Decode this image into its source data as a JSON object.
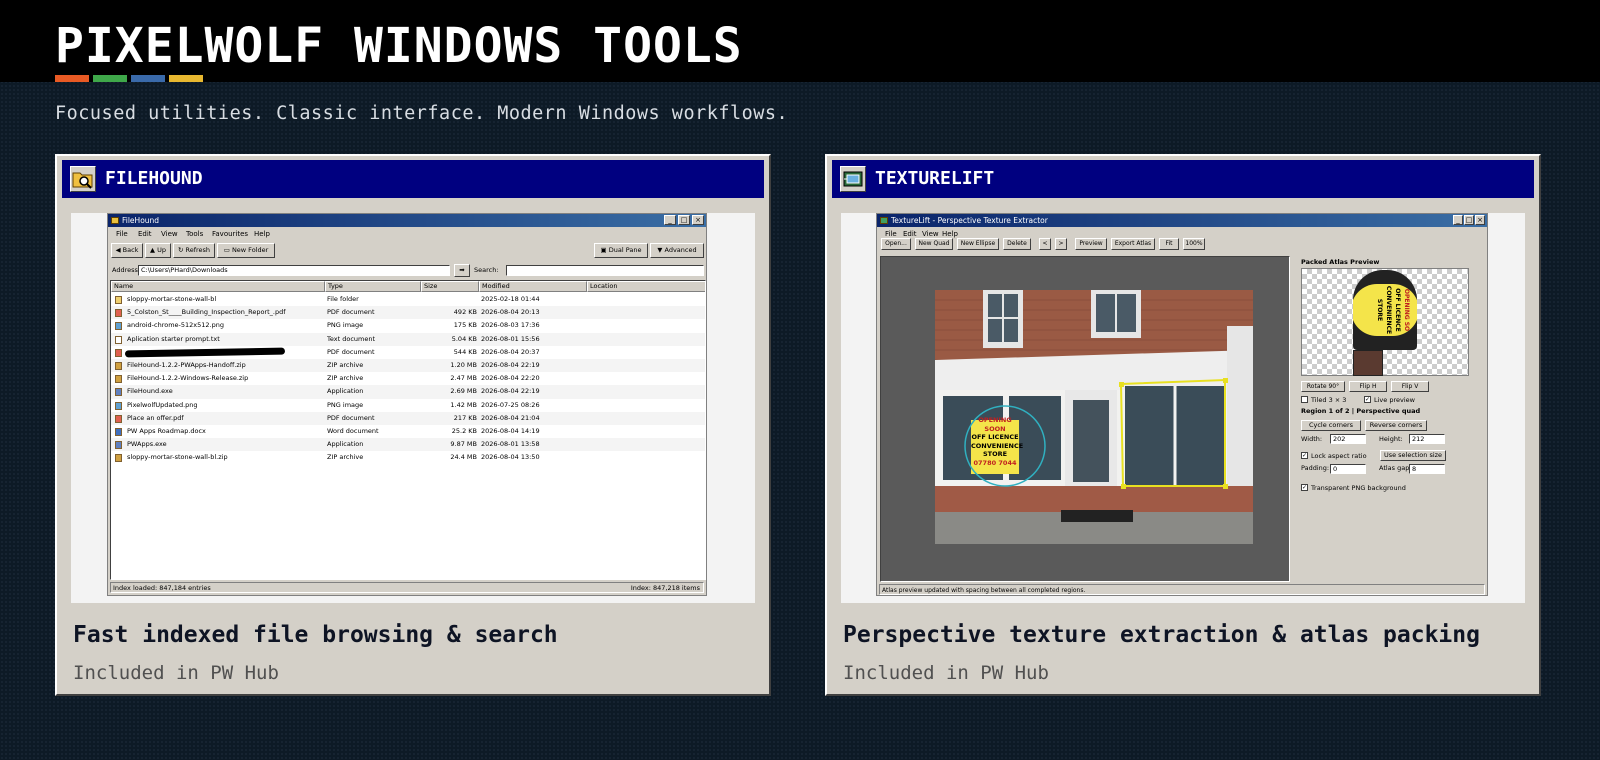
{
  "header": {
    "title": "PIXELWOLF WINDOWS TOOLS",
    "accent_colors": [
      "#e85a24",
      "#3fa84a",
      "#3a6aaa",
      "#e8b830"
    ],
    "tagline": "Focused utilities. Classic interface. Modern Windows workflows."
  },
  "products": [
    {
      "name": "FILEHOUND",
      "icon": "folder-search-icon",
      "caption": "Fast indexed file browsing & search",
      "subcaption": "Included in PW Hub",
      "screenshot": {
        "window_title": "FileHound",
        "menu": [
          "File",
          "Edit",
          "View",
          "Tools",
          "Favourites",
          "Help"
        ],
        "toolbar": [
          "Back",
          "Up",
          "Refresh",
          "New Folder"
        ],
        "toolbar_right": [
          "Dual Pane",
          "Advanced"
        ],
        "address_label": "Address:",
        "address_value": "C:\\Users\\PHard\\Downloads",
        "search_label": "Search:",
        "columns": [
          "Name",
          "Type",
          "Size",
          "Modified",
          "Location"
        ],
        "rows": [
          {
            "name": "sloppy-mortar-stone-wall-bl",
            "type": "File folder",
            "size": "",
            "modified": "2025-02-18 01:44"
          },
          {
            "name": "5_Colston_St____Building_Inspection_Report_.pdf",
            "type": "PDF document",
            "size": "492 KB",
            "modified": "2026-08-04 20:13"
          },
          {
            "name": "android-chrome-512x512.png",
            "type": "PNG image",
            "size": "175 KB",
            "modified": "2026-08-03 17:36"
          },
          {
            "name": "Aplication starter prompt.txt",
            "type": "Text document",
            "size": "5.04 KB",
            "modified": "2026-08-01 15:56"
          },
          {
            "name": "",
            "type": "PDF document",
            "size": "544 KB",
            "modified": "2026-08-04 20:37"
          },
          {
            "name": "FileHound-1.2.2-PWApps-Handoff.zip",
            "type": "ZIP archive",
            "size": "1.20 MB",
            "modified": "2026-08-04 22:19"
          },
          {
            "name": "FileHound-1.2.2-Windows-Release.zip",
            "type": "ZIP archive",
            "size": "2.47 MB",
            "modified": "2026-08-04 22:20"
          },
          {
            "name": "FileHound.exe",
            "type": "Application",
            "size": "2.69 MB",
            "modified": "2026-08-04 22:19"
          },
          {
            "name": "PixelwolfUpdated.png",
            "type": "PNG image",
            "size": "1.42 MB",
            "modified": "2026-07-25 08:26"
          },
          {
            "name": "Place an offer.pdf",
            "type": "PDF document",
            "size": "217 KB",
            "modified": "2026-08-04 21:04"
          },
          {
            "name": "PW Apps Roadmap.docx",
            "type": "Word document",
            "size": "25.2 KB",
            "modified": "2026-08-04 14:19"
          },
          {
            "name": "PWApps.exe",
            "type": "Application",
            "size": "9.87 MB",
            "modified": "2026-08-01 13:58"
          },
          {
            "name": "sloppy-mortar-stone-wall-bl.zip",
            "type": "ZIP archive",
            "size": "24.4 MB",
            "modified": "2026-08-04 13:50"
          }
        ],
        "status_left": "Index loaded: 847,184 entries",
        "status_right": "Index: 847,218 items"
      }
    },
    {
      "name": "TEXTURELIFT",
      "icon": "texture-icon",
      "caption": "Perspective texture extraction & atlas packing",
      "subcaption": "Included in PW Hub",
      "screenshot": {
        "window_title": "TextureLift - Perspective Texture Extractor",
        "menu": [
          "File",
          "Edit",
          "View",
          "Help"
        ],
        "toolbar": [
          "Open...",
          "New Quad",
          "New Ellipse",
          "Delete",
          "<",
          ">",
          "Preview",
          "Export Atlas",
          "Fit",
          "100%"
        ],
        "panel_title": "Packed Atlas Preview",
        "buttons_row1": [
          "Rotate 90°",
          "Flip H",
          "Flip V"
        ],
        "tiled_label": "Tiled 3 × 3",
        "live_preview_label": "Live preview",
        "region_label": "Region 1 of 2  |  Perspective quad",
        "buttons_row2": [
          "Cycle corners",
          "Reverse corners"
        ],
        "width_label": "Width:",
        "width_value": "202",
        "height_label": "Height:",
        "height_value": "212",
        "lock_label": "Lock aspect ratio",
        "use_selection_label": "Use selection size",
        "padding_label": "Padding:",
        "padding_value": "0",
        "gap_label": "Atlas gap:",
        "gap_value": "8",
        "transparent_label": "Transparent PNG background",
        "status": "Atlas preview updated with spacing between all completed regions.",
        "sign_text": [
          "OPENING SOON",
          "OFF LICENCE",
          "CONVENIENCE",
          "STORE",
          "07780 7044"
        ],
        "atlas_text": [
          "OPENING SO",
          "OFF LICENCE",
          "CONVENIENCE",
          "STORE"
        ]
      }
    }
  ]
}
